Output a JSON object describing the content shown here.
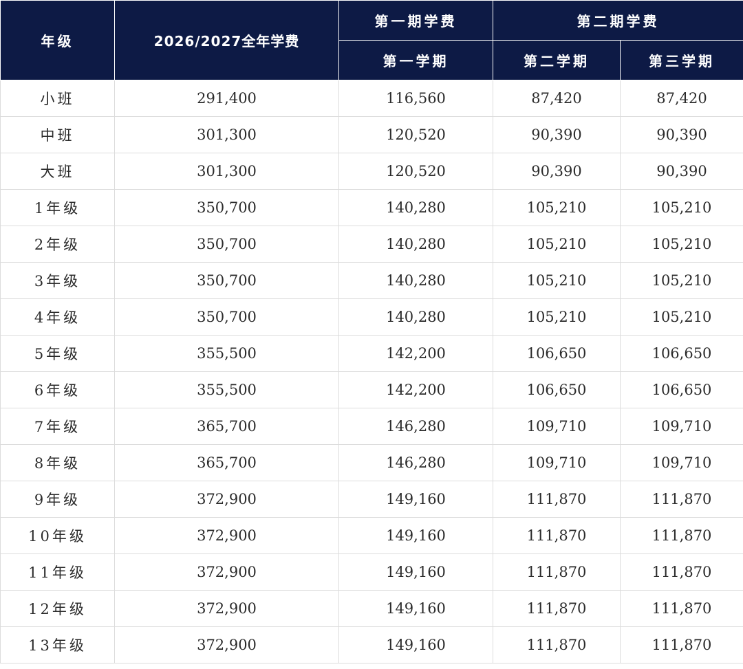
{
  "header": {
    "grade": "年级",
    "annual": "2026/2027全年学费",
    "period1": "第一期学费",
    "period2": "第二期学费",
    "term1": "第一学期",
    "term2": "第二学期",
    "term3": "第三学期"
  },
  "rows": [
    {
      "grade": "小班",
      "annual": "291,400",
      "term1": "116,560",
      "term2": "87,420",
      "term3": "87,420"
    },
    {
      "grade": "中班",
      "annual": "301,300",
      "term1": "120,520",
      "term2": "90,390",
      "term3": "90,390"
    },
    {
      "grade": "大班",
      "annual": "301,300",
      "term1": "120,520",
      "term2": "90,390",
      "term3": "90,390"
    },
    {
      "grade": "1年级",
      "annual": "350,700",
      "term1": "140,280",
      "term2": "105,210",
      "term3": "105,210"
    },
    {
      "grade": "2年级",
      "annual": "350,700",
      "term1": "140,280",
      "term2": "105,210",
      "term3": "105,210"
    },
    {
      "grade": "3年级",
      "annual": "350,700",
      "term1": "140,280",
      "term2": "105,210",
      "term3": "105,210"
    },
    {
      "grade": "4年级",
      "annual": "350,700",
      "term1": "140,280",
      "term2": "105,210",
      "term3": "105,210"
    },
    {
      "grade": "5年级",
      "annual": "355,500",
      "term1": "142,200",
      "term2": "106,650",
      "term3": "106,650"
    },
    {
      "grade": "6年级",
      "annual": "355,500",
      "term1": "142,200",
      "term2": "106,650",
      "term3": "106,650"
    },
    {
      "grade": "7年级",
      "annual": "365,700",
      "term1": "146,280",
      "term2": "109,710",
      "term3": "109,710"
    },
    {
      "grade": "8年级",
      "annual": "365,700",
      "term1": "146,280",
      "term2": "109,710",
      "term3": "109,710"
    },
    {
      "grade": "9年级",
      "annual": "372,900",
      "term1": "149,160",
      "term2": "111,870",
      "term3": "111,870"
    },
    {
      "grade": "10年级",
      "annual": "372,900",
      "term1": "149,160",
      "term2": "111,870",
      "term3": "111,870"
    },
    {
      "grade": "11年级",
      "annual": "372,900",
      "term1": "149,160",
      "term2": "111,870",
      "term3": "111,870"
    },
    {
      "grade": "12年级",
      "annual": "372,900",
      "term1": "149,160",
      "term2": "111,870",
      "term3": "111,870"
    },
    {
      "grade": "13年级",
      "annual": "372,900",
      "term1": "149,160",
      "term2": "111,870",
      "term3": "111,870"
    }
  ],
  "colors": {
    "header_bg": "#0d1a45",
    "header_text": "#ffffff",
    "cell_text": "#2b2b2b",
    "grid_line": "#dcdcdc"
  }
}
